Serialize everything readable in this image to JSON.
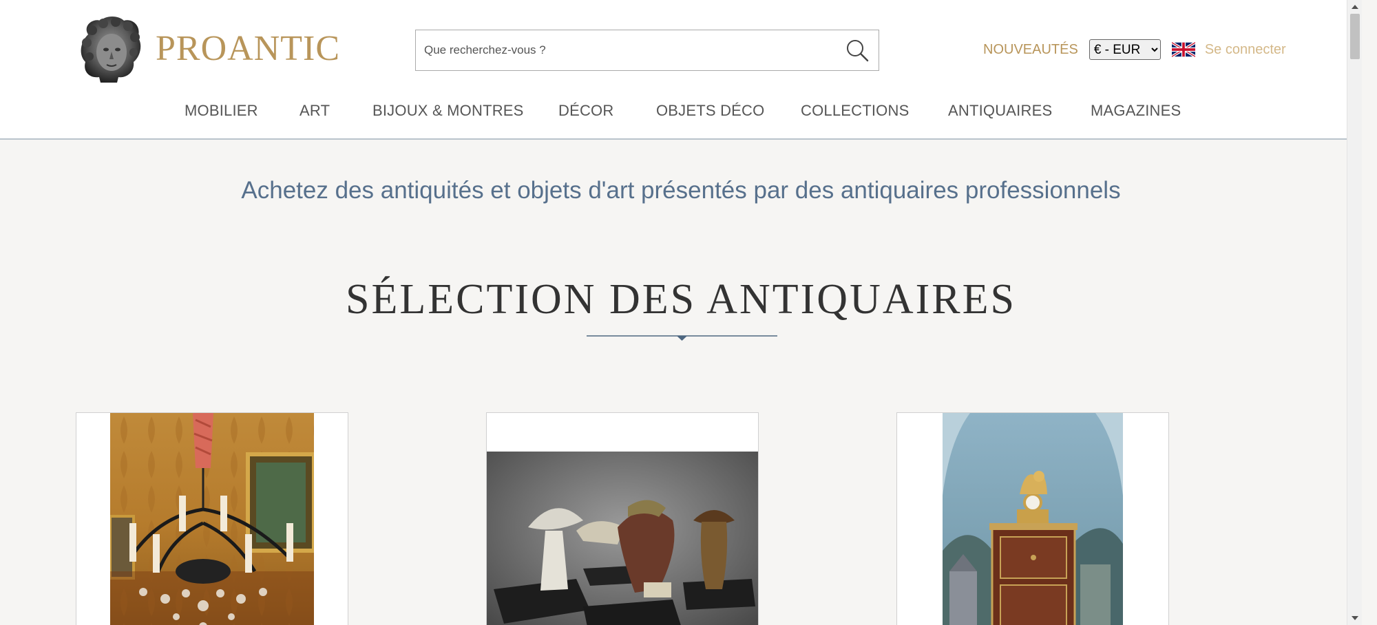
{
  "brand": {
    "name": "PROANTIC",
    "color": "#b8955a"
  },
  "search": {
    "placeholder": "Que recherchez-vous ?",
    "icon": "search-icon"
  },
  "header": {
    "nouveautes": "NOUVEAUTÉS",
    "currency": {
      "selected": "€ - EUR"
    },
    "language_flag": "uk-flag-icon",
    "login": "Se connecter"
  },
  "nav": {
    "items": [
      {
        "label": "MOBILIER"
      },
      {
        "label": "ART"
      },
      {
        "label": "BIJOUX & MONTRES"
      },
      {
        "label": "DÉCOR"
      },
      {
        "label": "OBJETS DÉCO"
      },
      {
        "label": "COLLECTIONS"
      },
      {
        "label": "ANTIQUAIRES"
      },
      {
        "label": "MAGAZINES"
      }
    ]
  },
  "main": {
    "tagline": "Achetez des antiquités et objets d'art présentés par des antiquaires professionnels",
    "section_title": "SÉLECTION DES ANTIQUAIRES",
    "cards": [
      {
        "image": "chandelier-photo"
      },
      {
        "image": "mushroom-sculptures-photo"
      },
      {
        "image": "secretary-desk-clock-photo"
      }
    ]
  },
  "colors": {
    "accent_gold": "#b8955a",
    "tagline_blue": "#57708c",
    "divider_blue": "#4d6680",
    "page_background": "#f6f5f3"
  }
}
